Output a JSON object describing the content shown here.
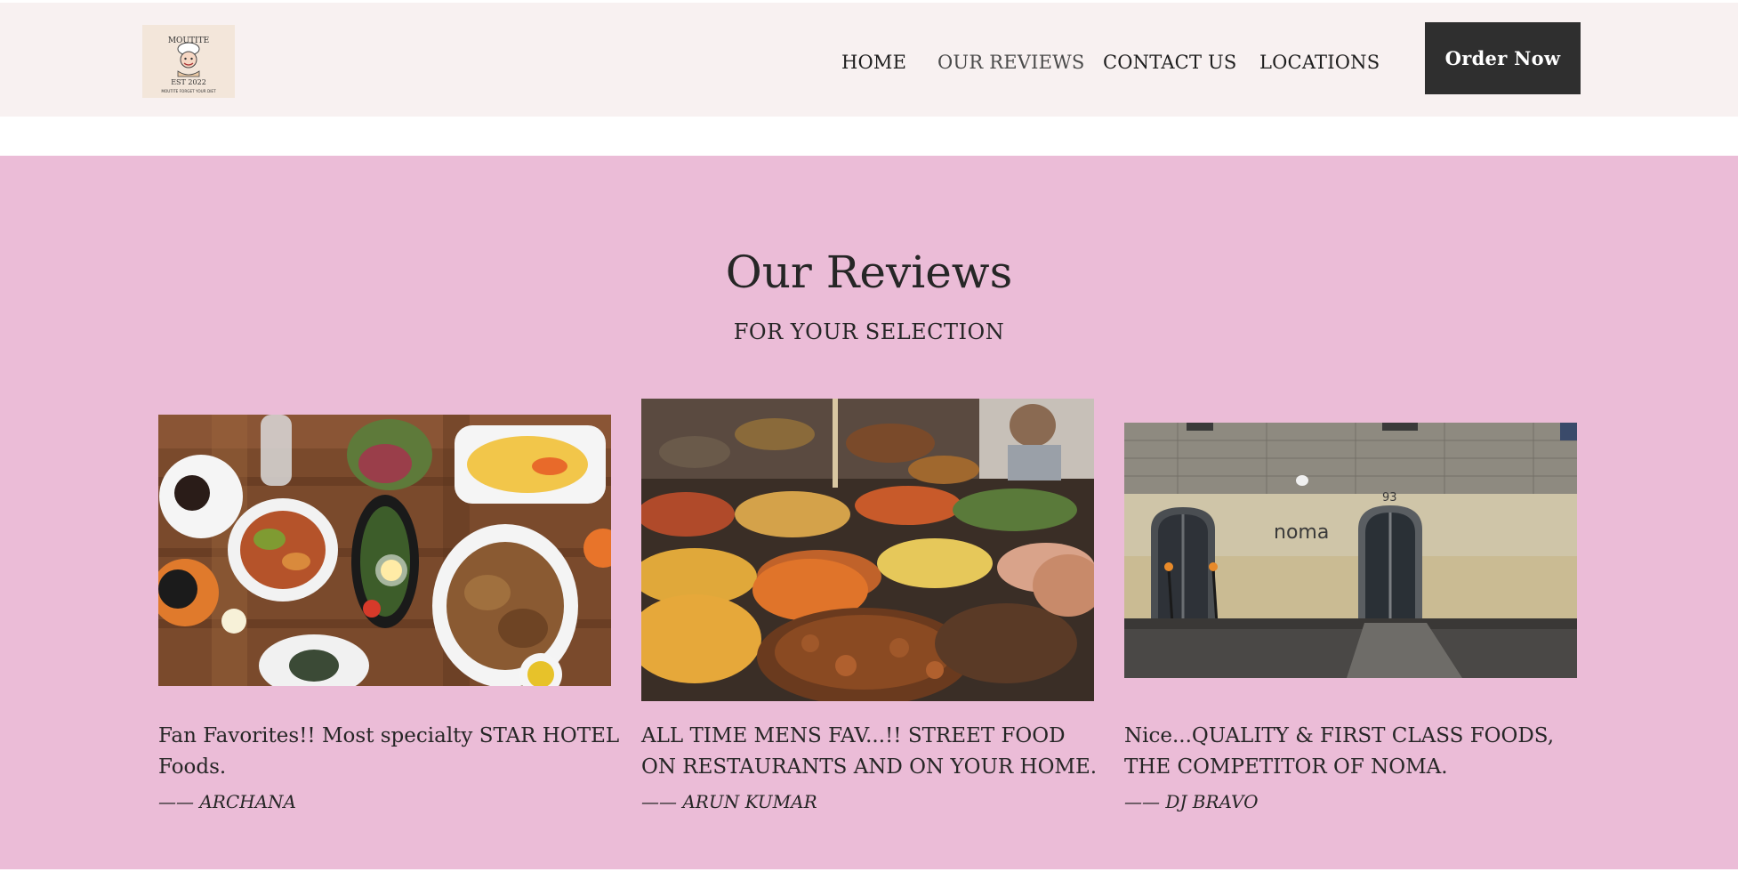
{
  "header": {
    "logo": {
      "top_text": "MOUTITE",
      "est_text": "EST 2022",
      "bottom_text": "MOUTITE FORGET YOUR DIET"
    },
    "nav": [
      {
        "label": "HOME",
        "active": false
      },
      {
        "label": "OUR REVIEWS",
        "active": true
      },
      {
        "label": "CONTACT US",
        "active": false
      },
      {
        "label": "LOCATIONS",
        "active": false
      }
    ],
    "order_button": "Order Now"
  },
  "reviews": {
    "title": "Our Reviews",
    "subtitle": "FOR YOUR SELECTION",
    "background_color": "#ebbcd7",
    "cards": [
      {
        "image": "food-table-photo",
        "quote": "Fan Favorites!! Most specialty STAR HOTEL Foods.",
        "author": "—— ARCHANA"
      },
      {
        "image": "street-food-market-photo",
        "quote": "ALL TIME MENS FAV...!! STREET FOOD ON RESTAURANTS AND ON YOUR HOME.",
        "author": "—— ARUN KUMAR"
      },
      {
        "image": "noma-restaurant-facade-photo",
        "sign_text": "noma",
        "house_number": "93",
        "quote": "Nice...QUALITY & FIRST CLASS FOODS, THE COMPETITOR OF NOMA.",
        "author": "—— DJ BRAVO"
      }
    ]
  },
  "colors": {
    "header_bg": "#f8f1f1",
    "button_bg": "#2f2f2f",
    "text": "#262626"
  }
}
